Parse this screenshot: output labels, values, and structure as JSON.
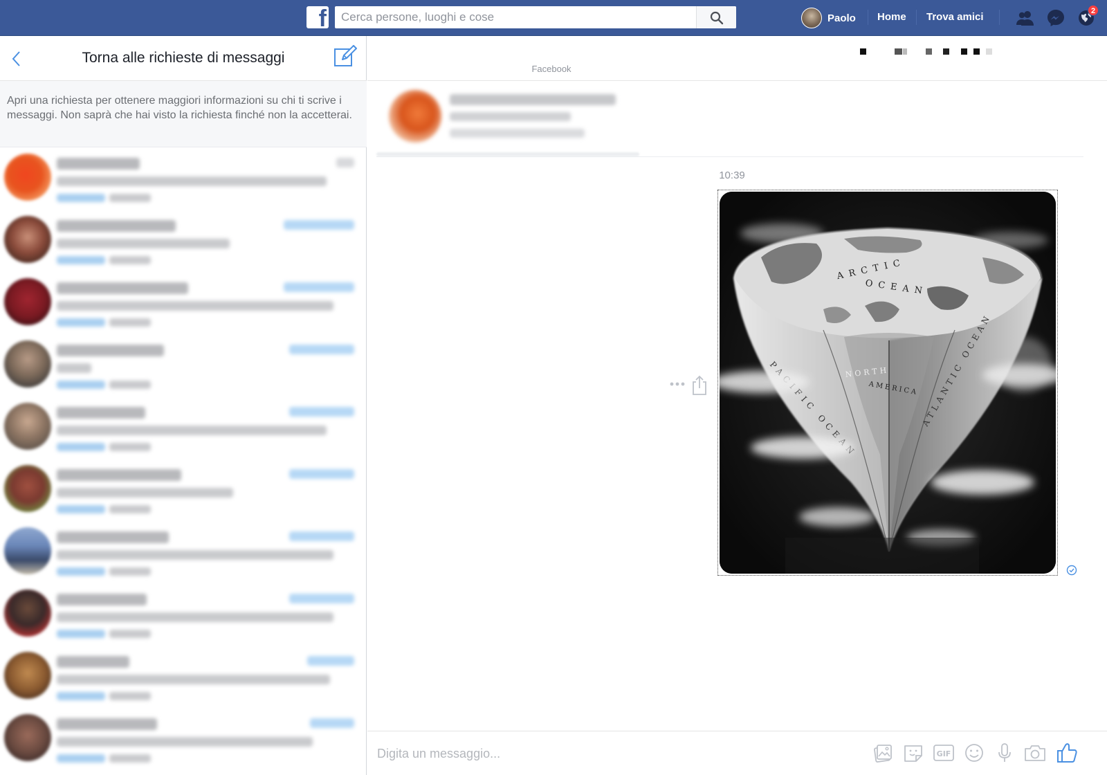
{
  "topbar": {
    "search_placeholder": "Cerca persone, luoghi e cose",
    "user_name": "Paolo",
    "home_label": "Home",
    "find_friends_label": "Trova amici",
    "notifications_badge": "2",
    "colors": {
      "bar": "#3b5998",
      "badge": "#fa3e3e"
    }
  },
  "left_panel": {
    "title": "Torna alle richieste di messaggi",
    "info_text": "Apri una richiesta per ottenere maggiori informazioni su chi ti scrive i messaggi. Non saprà che hai visto la richiesta finché non la accetterai."
  },
  "conversation": {
    "subtitle": "Facebook",
    "timestamp": "10:39",
    "image_labels": {
      "arctic": "ARCTIC",
      "ocean_top": "OCEAN",
      "north": "NORTH",
      "america": "AMERICA",
      "pacific": "PACIFIC OCEAN",
      "atlantic": "ATLANTIC OCEAN"
    }
  },
  "composer": {
    "placeholder": "Digita un messaggio..."
  },
  "icons": {
    "search": "search-icon",
    "back": "chevron-left-icon",
    "compose": "compose-icon",
    "friends": "friend-requests-icon",
    "messenger": "messenger-icon",
    "globe": "globe-icon",
    "photo": "photo-icon",
    "sticker": "sticker-icon",
    "gif": "gif-icon",
    "emoji": "emoji-icon",
    "mic": "microphone-icon",
    "camera": "camera-icon",
    "like": "thumbs-up-icon"
  }
}
